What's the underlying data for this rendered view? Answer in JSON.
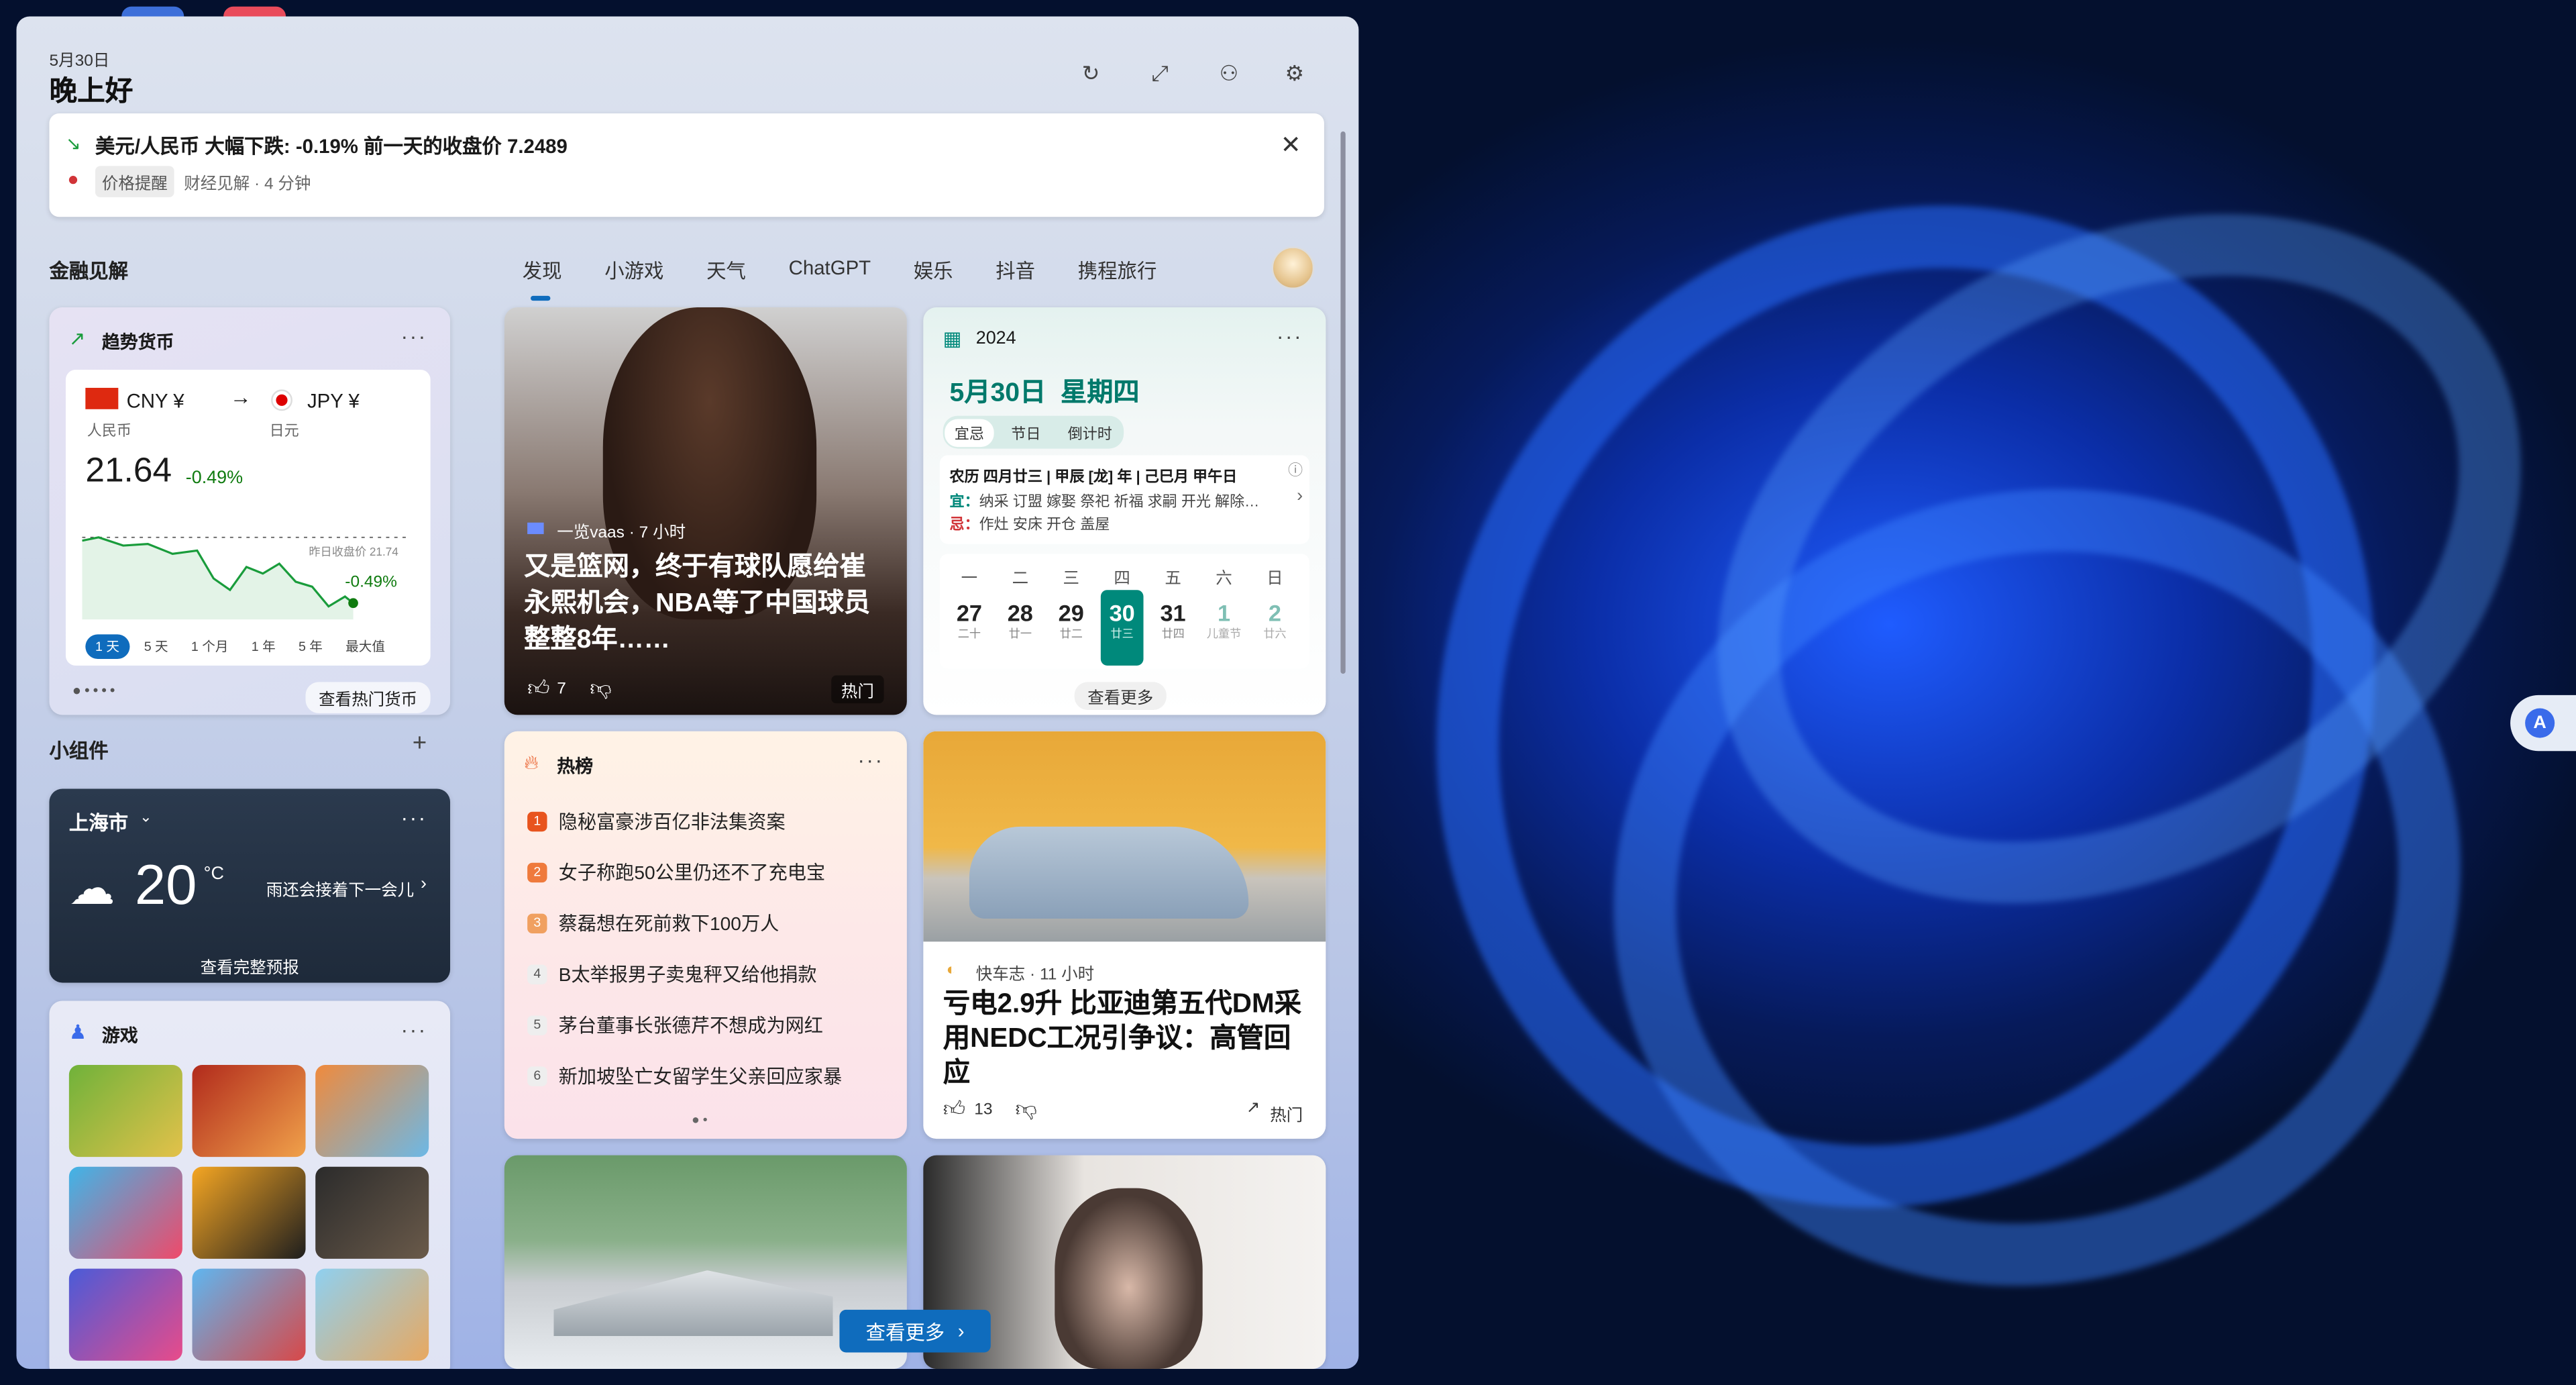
{
  "header": {
    "date": "5月30日",
    "greeting": "晚上好"
  },
  "alert": {
    "title": "美元/人民币 大幅下跌: -0.19% 前一天的收盘价 7.2489",
    "tag": "价格提醒",
    "source": "财经见解 · 4 分钟"
  },
  "left": {
    "finance_title": "金融见解",
    "currency": {
      "title": "趋势货币",
      "from_code": "CNY ¥",
      "from_name": "人民币",
      "to_code": "JPY ¥",
      "to_name": "日元",
      "rate": "21.64",
      "change": "-0.49%",
      "chart_ref": "昨日收盘价 21.74",
      "chart_change": "-0.49%",
      "ranges": [
        "1 天",
        "5 天",
        "1 个月",
        "1 年",
        "5 年",
        "最大值"
      ],
      "link": "查看热门货币"
    },
    "widgets_title": "小组件",
    "weather": {
      "city": "上海市",
      "temp": "20",
      "unit": "°C",
      "desc": "雨还会接着下一会儿",
      "link": "查看完整预报"
    },
    "games": {
      "title": "游戏"
    }
  },
  "tabs": [
    "发现",
    "小游戏",
    "天气",
    "ChatGPT",
    "娱乐",
    "抖音",
    "携程旅行"
  ],
  "news1": {
    "source": "一览vaas · 7 小时",
    "headline": "又是篮网，终于有球队愿给崔永熙机会，NBA等了中国球员整整8年……",
    "likes": "7",
    "hot": "热门"
  },
  "calendar": {
    "year": "2024",
    "date": "5月30日  星期四",
    "tabs": [
      "宜忌",
      "节日",
      "倒计时"
    ],
    "lunar": "农历 四月廿三 | 甲辰 [龙] 年 | 己巳月 甲午日",
    "yi_label": "宜：",
    "yi": "纳采 订盟 嫁娶 祭祀 祈福 求嗣 开光 解除…",
    "ji_label": "忌：",
    "ji": "作灶 安床 开仓 盖屋",
    "weekdays": [
      "一",
      "二",
      "三",
      "四",
      "五",
      "六",
      "日"
    ],
    "days": [
      {
        "n": "27",
        "l": "二十"
      },
      {
        "n": "28",
        "l": "廿一"
      },
      {
        "n": "29",
        "l": "廿二"
      },
      {
        "n": "30",
        "l": "廿三"
      },
      {
        "n": "31",
        "l": "廿四"
      },
      {
        "n": "1",
        "l": "儿童节"
      },
      {
        "n": "2",
        "l": "廿六"
      }
    ],
    "more": "查看更多"
  },
  "hotlist": {
    "title": "热榜",
    "items": [
      "隐秘富豪涉百亿非法集资案",
      "女子称跑50公里仍还不了充电宝",
      "蔡磊想在死前救下100万人",
      "B太举报男子卖鬼秤又给他捐款",
      "茅台董事长张德芹不想成为网红",
      "新加坡坠亡女留学生父亲回应家暴"
    ]
  },
  "news2": {
    "source": "快车志 · 11 小时",
    "headline": "亏电2.9升 比亚迪第五代DM采用NEDC工况引争议：高管回应",
    "likes": "13",
    "hot": "热门"
  },
  "see_more": "查看更多",
  "colors": {
    "accent": "#0f6cbd",
    "teal": "#00897b",
    "up": "#0f7b0f",
    "down": "#d13438"
  }
}
